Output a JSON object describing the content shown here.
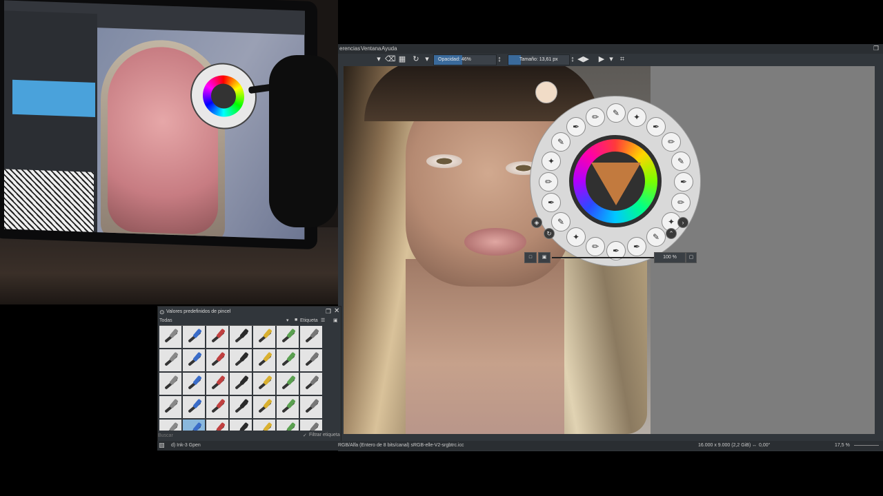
{
  "menubar": {
    "items": [
      "erencias",
      "Ventana",
      "Ayuda"
    ]
  },
  "toolbar": {
    "opacity_label": "Opacidad: 46%",
    "opacity_value": 0.46,
    "size_label": "Tamaño: 13,61 px"
  },
  "palette": {
    "zoom_label": "100 %"
  },
  "presets_docker": {
    "title": "Valores predefinidos de pincel",
    "filter_value": "Todas",
    "tag_label": "Etiqueta",
    "search_placeholder": "Buscar",
    "filter_tag_label": "Filtrar etiqueta",
    "selected_index": 29
  },
  "statusbar": {
    "brush_name": "d) Ink-3 Gpen",
    "color_info": "RGB/Alfa (Entero de 8 bits/canal)  sRGB-elle-V2-srgbtrc.icc",
    "doc_size": "16.000 x 9.000 (2,2 GiB)",
    "rotation": "0,00°",
    "zoom": "17,5 %"
  },
  "colors": {
    "accent": "#3a6a9b",
    "selected_brush": "#8ab8dd",
    "panel_bg": "#31363b"
  }
}
